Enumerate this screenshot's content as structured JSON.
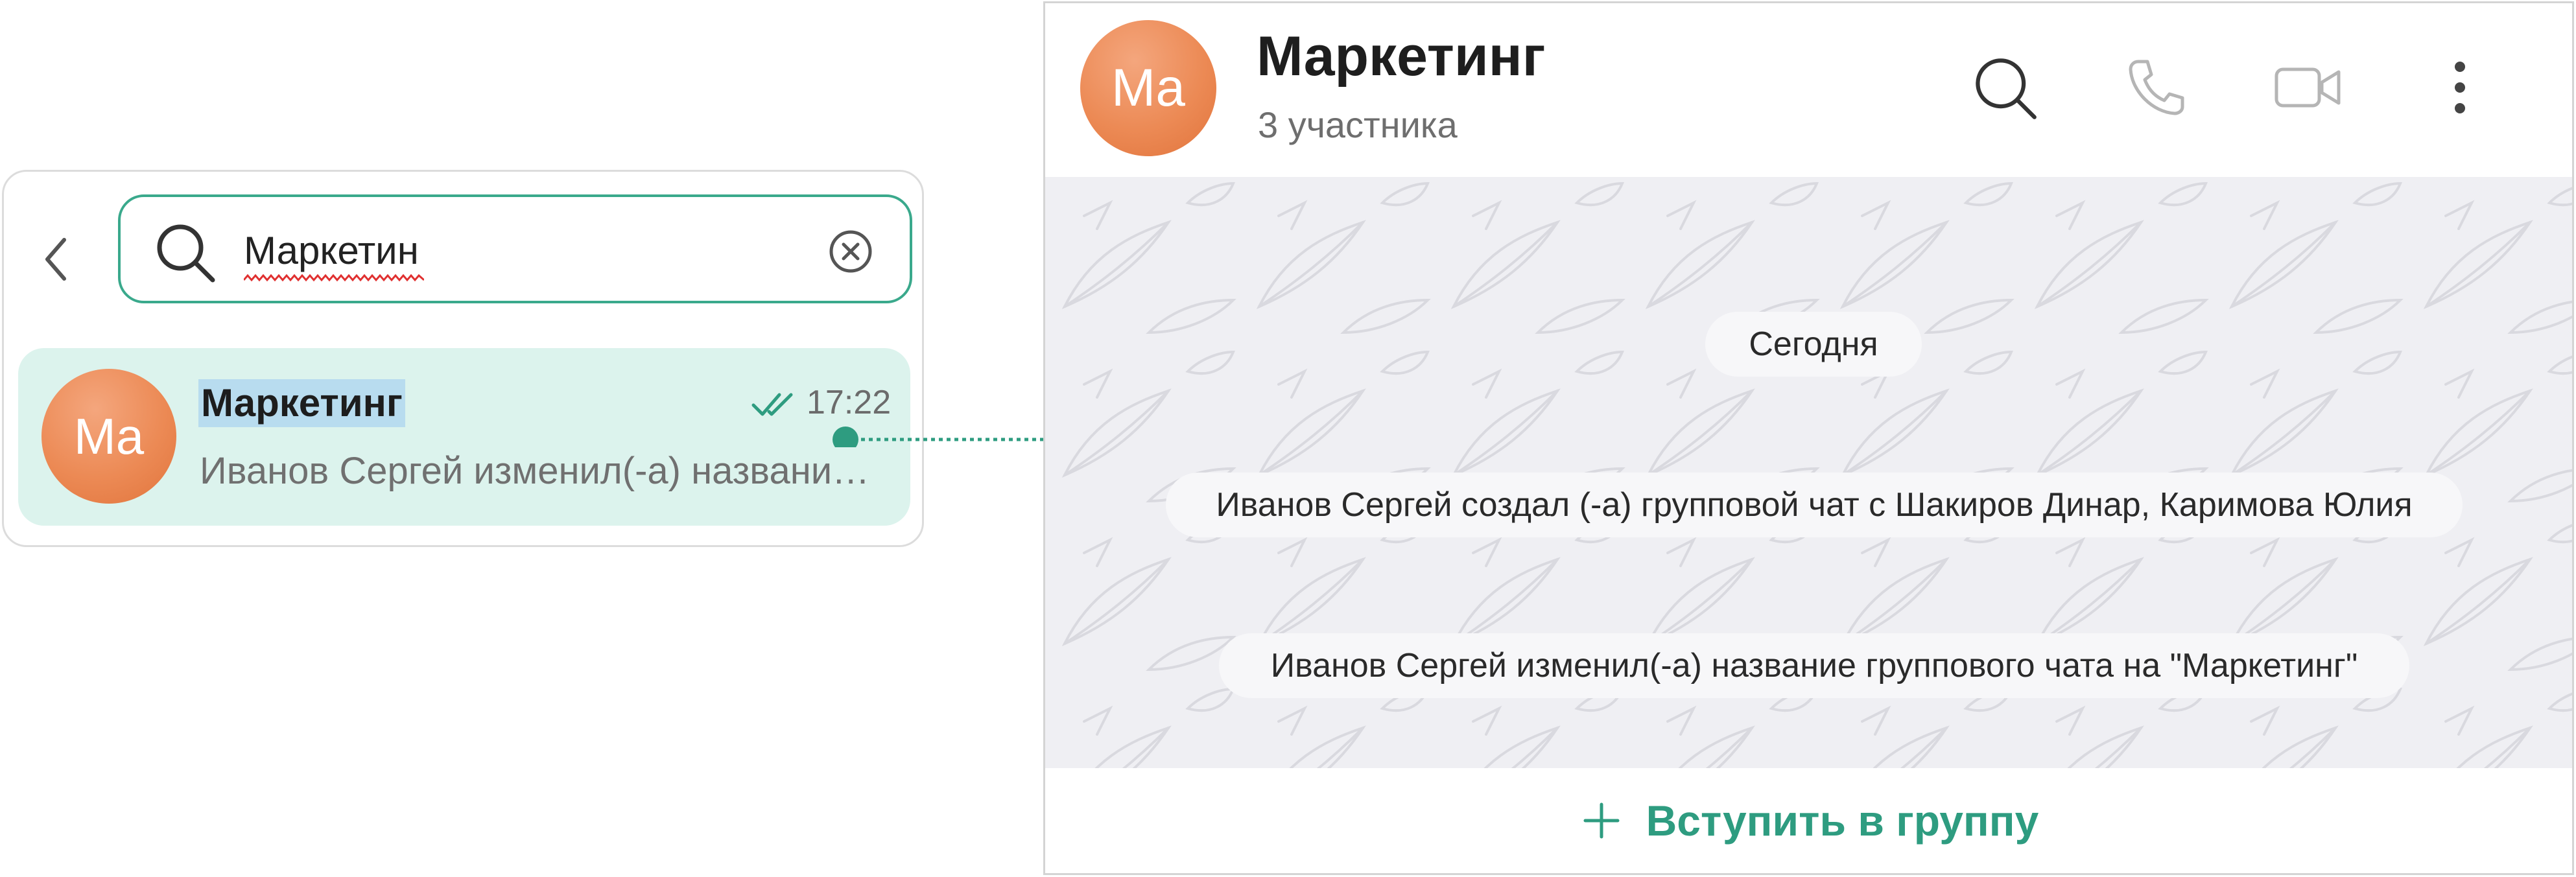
{
  "search": {
    "query": "Маркетин"
  },
  "result": {
    "avatar_initials": "Ma",
    "title": "Маркетинг",
    "time": "17:22",
    "preview": "Иванов Сергей изменил(-а) название группового чата на \"Маркетинг\"",
    "read_status_icon": "double-check-icon"
  },
  "chat": {
    "avatar_initials": "Ma",
    "title": "Маркетинг",
    "subtitle": "3 участника",
    "header_icons": [
      "search-icon",
      "phone-icon",
      "video-icon",
      "more-vertical-icon"
    ],
    "date_separator": "Сегодня",
    "system_messages": [
      "Иванов Сергей создал (-а) групповой чат с Шакиров Динар, Каримова Юлия",
      "Иванов Сергей изменил(-а) название группового чата на \"Маркетинг\""
    ],
    "join_button": "Вступить в группу"
  },
  "colors": {
    "accent": "#3aa98c",
    "join_text": "#2e9c80",
    "selected_bg": "#dcf3ed",
    "highlight": "#b8dcef",
    "avatar": "#ec8a55",
    "chat_bg": "#efeff3"
  }
}
